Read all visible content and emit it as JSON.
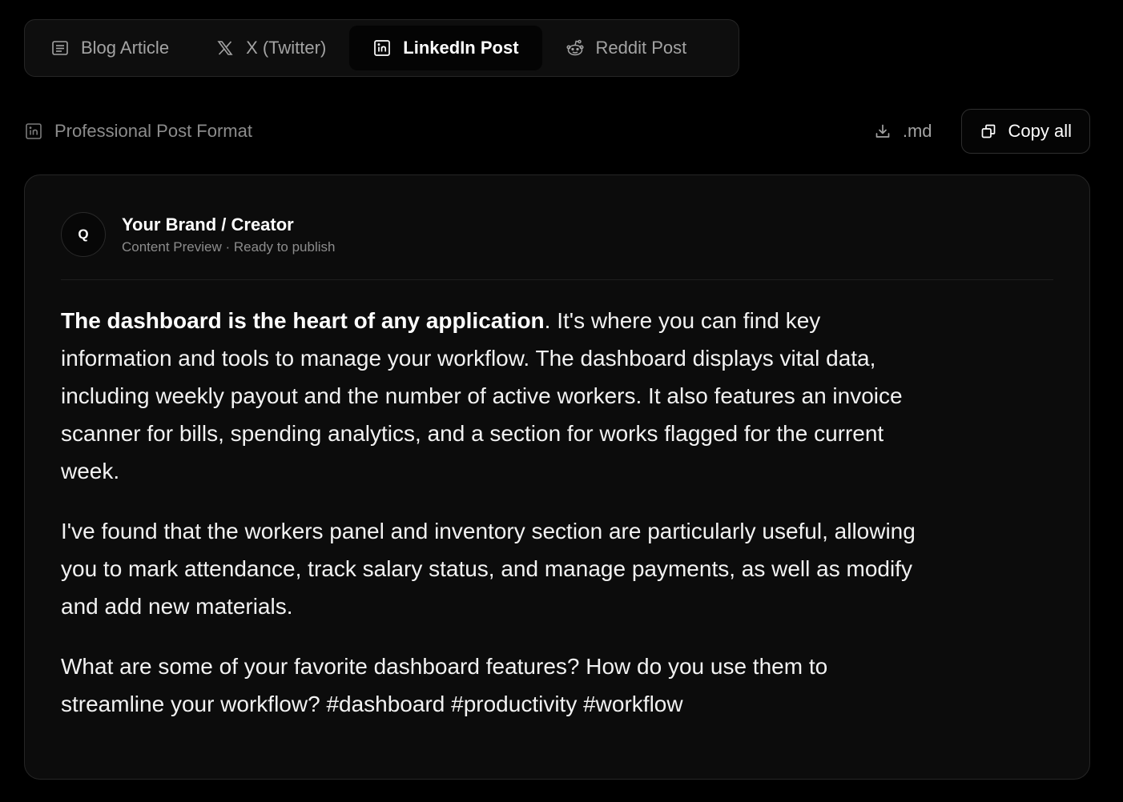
{
  "tabs": [
    {
      "label": "Blog Article",
      "icon": "document-icon",
      "active": false
    },
    {
      "label": "X (Twitter)",
      "icon": "x-logo-icon",
      "active": false
    },
    {
      "label": "LinkedIn Post",
      "icon": "linkedin-icon",
      "active": true
    },
    {
      "label": "Reddit Post",
      "icon": "reddit-icon",
      "active": false
    }
  ],
  "format": {
    "label": "Professional Post Format",
    "icon": "linkedin-icon"
  },
  "actions": {
    "md_label": ".md",
    "md_icon": "download-icon",
    "copy_label": "Copy all",
    "copy_icon": "copy-icon"
  },
  "post": {
    "avatar_initial": "Q",
    "author_name": "Your Brand / Creator",
    "author_sub": "Content Preview · Ready to publish",
    "p1_bold": "The dashboard is the heart of any application",
    "p1_rest": ". It's where you can find key information and tools to manage your workflow. The dashboard displays vital data, including weekly payout and the number of active workers. It also features an invoice scanner for bills, spending analytics, and a section for works flagged for the current week.",
    "p2": "I've found that the workers panel and inventory section are particularly useful, allowing you to mark attendance, track salary status, and manage payments, as well as modify and add new materials.",
    "p3": "What are some of your favorite dashboard features? How do you use them to streamline your workflow? #dashboard #productivity #workflow"
  },
  "colors": {
    "background": "#000000",
    "card": "#0c0c0c",
    "border": "#262626",
    "muted_text": "#a3a3a3"
  }
}
